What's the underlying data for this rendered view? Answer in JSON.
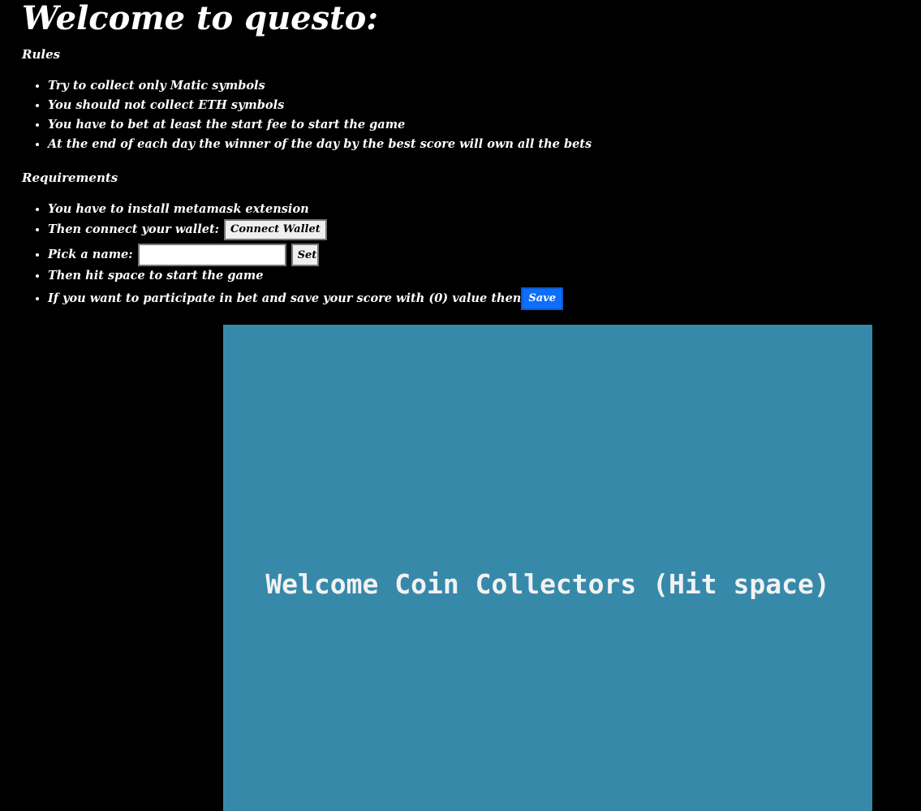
{
  "header": {
    "title": "Welcome to questo:"
  },
  "rules": {
    "heading": "Rules",
    "items": [
      "Try to collect only Matic symbols",
      "You should not collect ETH symbols",
      "You have to bet at least the start fee to start the game",
      "At the end of each day the winner of the day by the best score will own all the bets"
    ]
  },
  "requirements": {
    "heading": "Requirements",
    "install_text": "You have to install metamask extension",
    "connect_text": "Then connect your wallet:",
    "connect_button": "Connect Wallet",
    "name_text": "Pick a name:",
    "name_input_value": "",
    "set_button": "Set",
    "start_text": "Then hit space to start the game",
    "save_text": "If you want to participate in bet and save your score with (0) value then",
    "save_button": "Save"
  },
  "game": {
    "message": "Welcome Coin Collectors (Hit space)",
    "background_color": "#3789aa"
  },
  "colors": {
    "page_background": "#000000",
    "text": "#ffffff",
    "save_button": "#0d6efd"
  }
}
